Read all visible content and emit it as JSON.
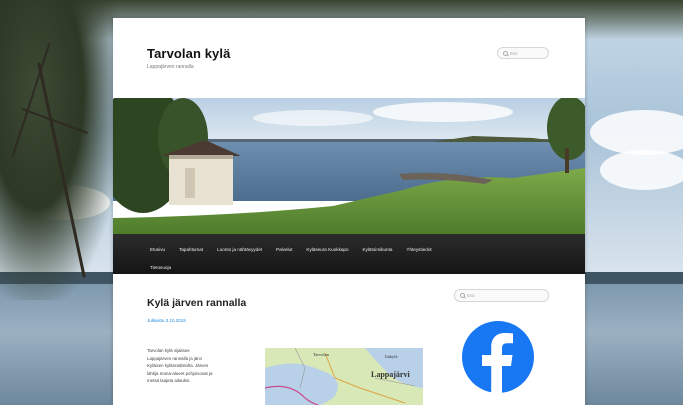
{
  "site": {
    "title": "Tarvolan kylä",
    "description": "Lappajärven rannalla"
  },
  "header_search": {
    "placeholder": "Etsi"
  },
  "nav": {
    "row1": [
      "Etusivu",
      "Tapahtumat",
      "Luonto ja nähtävyydet",
      "Palvelut",
      "Kyläseura Kuokkapo",
      "Kylätoimikunta",
      "Yhteystiedot"
    ],
    "row2": [
      "Tietosuoja"
    ]
  },
  "post": {
    "title": "Kylä järven rannalla",
    "date": "Julkaistu 3.10.2019",
    "text_lines": [
      "Tarvolan kylä sijaitsee",
      "Lappajärven rannalla ja järvi",
      "Kyläisen kylänraitistolta. Järven",
      "lahtija reuna-alueet pohjoisosat ja",
      "metsä laajeta aitauksi."
    ],
    "map_labels": [
      "Tarvolan",
      "Lappajärvi",
      "Itäkylä"
    ]
  },
  "sidebar_search": {
    "placeholder": "Etsi"
  },
  "social": {
    "icon": "facebook-icon",
    "color": "#1877f2"
  },
  "colors": {
    "nav_bg": "#1a1a1a",
    "link": "#1b8be0",
    "title": "#111111"
  }
}
